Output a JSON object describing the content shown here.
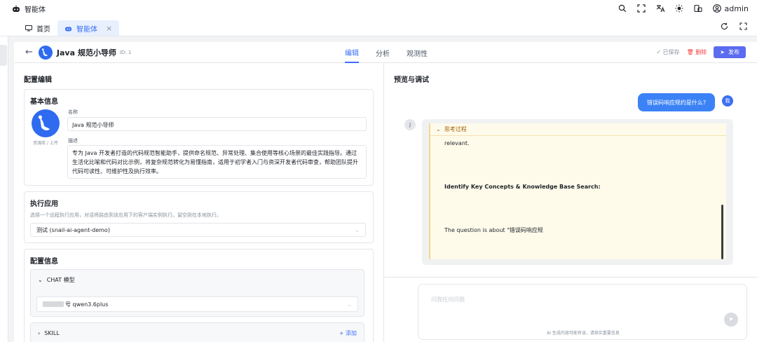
{
  "topbar": {
    "brand": "智能体",
    "user": "admin"
  },
  "tabs": [
    {
      "label": "首页"
    },
    {
      "label": "智能体",
      "close": "×"
    }
  ],
  "agent": {
    "name": "Java 规范小导师",
    "id_label": "ID: 1",
    "nav": [
      "编辑",
      "分析",
      "观测性"
    ],
    "saved": "已保存",
    "delete": "删除",
    "publish": "发布"
  },
  "config": {
    "title": "配置编辑",
    "basic": {
      "title": "基本信息",
      "avatar_caption": "资源库 / 上传",
      "name_label": "名称",
      "name_value": "Java 规范小导师",
      "desc_label": "描述",
      "desc_value": "专为 Java 开发者打造的代码规范智能助手，提供命名规范、异常处理、集合使用等核心场景的最佳实践指导。通过生活化比喻和代码对比示例，将复杂规范转化为易懂指南，适用于初学者入门与资深开发者代码审查，帮助团队提升代码可读性、可维护性及执行效率。"
    },
    "exec": {
      "title": "执行应用",
      "hint": "选择一个远程执行应用，对话将路由到该应用下的客户端实例执行。留空则在本地执行。",
      "value": "测试 (snail-ai-agent-demo)"
    },
    "settings": {
      "title": "配置信息",
      "chat_label": "CHAT 模型",
      "chat_value": "号 qwen3.6plus",
      "skill_label": "SKILL",
      "add_label": "+ 添加"
    }
  },
  "preview": {
    "title": "预览与调试",
    "user_message": "错误码响应规约是什么?",
    "user_avatar": "我",
    "bot_avatar": "J",
    "thinking_label": "思考过程",
    "thinking_lines": [
      "relevant.",
      "Identify Key Concepts & Knowledge Base Search:",
      "The question is about \"错误码响应规"
    ],
    "input_placeholder": "问我任何问题",
    "disclaimer": "AI 生成内容可能有误，请核实重要信息"
  }
}
